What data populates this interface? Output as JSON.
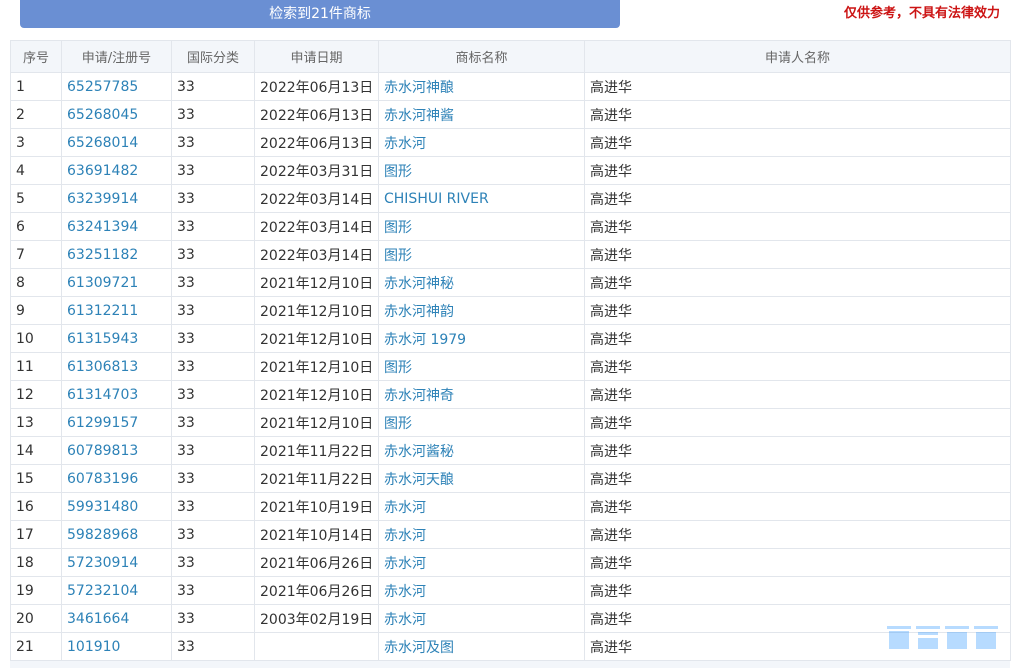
{
  "header": {
    "result_label": "检索到21件商标",
    "disclaimer": "仅供参考，不具有法律效力"
  },
  "columns": [
    "序号",
    "申请/注册号",
    "国际分类",
    "申请日期",
    "商标名称",
    "申请人名称"
  ],
  "rows": [
    {
      "no": "1",
      "reg": "65257785",
      "cls": "33",
      "date": "2022年06月13日",
      "name": "赤水河神酿",
      "applicant": "高进华"
    },
    {
      "no": "2",
      "reg": "65268045",
      "cls": "33",
      "date": "2022年06月13日",
      "name": "赤水河神酱",
      "applicant": "高进华"
    },
    {
      "no": "3",
      "reg": "65268014",
      "cls": "33",
      "date": "2022年06月13日",
      "name": "赤水河",
      "applicant": "高进华"
    },
    {
      "no": "4",
      "reg": "63691482",
      "cls": "33",
      "date": "2022年03月31日",
      "name": "图形",
      "applicant": "高进华"
    },
    {
      "no": "5",
      "reg": "63239914",
      "cls": "33",
      "date": "2022年03月14日",
      "name": "CHISHUI RIVER",
      "applicant": "高进华"
    },
    {
      "no": "6",
      "reg": "63241394",
      "cls": "33",
      "date": "2022年03月14日",
      "name": "图形",
      "applicant": "高进华"
    },
    {
      "no": "7",
      "reg": "63251182",
      "cls": "33",
      "date": "2022年03月14日",
      "name": "图形",
      "applicant": "高进华"
    },
    {
      "no": "8",
      "reg": "61309721",
      "cls": "33",
      "date": "2021年12月10日",
      "name": "赤水河神秘",
      "applicant": "高进华"
    },
    {
      "no": "9",
      "reg": "61312211",
      "cls": "33",
      "date": "2021年12月10日",
      "name": "赤水河神韵",
      "applicant": "高进华"
    },
    {
      "no": "10",
      "reg": "61315943",
      "cls": "33",
      "date": "2021年12月10日",
      "name": "赤水河 1979",
      "applicant": "高进华"
    },
    {
      "no": "11",
      "reg": "61306813",
      "cls": "33",
      "date": "2021年12月10日",
      "name": "图形",
      "applicant": "高进华"
    },
    {
      "no": "12",
      "reg": "61314703",
      "cls": "33",
      "date": "2021年12月10日",
      "name": "赤水河神奇",
      "applicant": "高进华"
    },
    {
      "no": "13",
      "reg": "61299157",
      "cls": "33",
      "date": "2021年12月10日",
      "name": "图形",
      "applicant": "高进华"
    },
    {
      "no": "14",
      "reg": "60789813",
      "cls": "33",
      "date": "2021年11月22日",
      "name": "赤水河酱秘",
      "applicant": "高进华"
    },
    {
      "no": "15",
      "reg": "60783196",
      "cls": "33",
      "date": "2021年11月22日",
      "name": "赤水河天酿",
      "applicant": "高进华"
    },
    {
      "no": "16",
      "reg": "59931480",
      "cls": "33",
      "date": "2021年10月19日",
      "name": "赤水河",
      "applicant": "高进华"
    },
    {
      "no": "17",
      "reg": "59828968",
      "cls": "33",
      "date": "2021年10月14日",
      "name": "赤水河",
      "applicant": "高进华"
    },
    {
      "no": "18",
      "reg": "57230914",
      "cls": "33",
      "date": "2021年06月26日",
      "name": "赤水河",
      "applicant": "高进华"
    },
    {
      "no": "19",
      "reg": "57232104",
      "cls": "33",
      "date": "2021年06月26日",
      "name": "赤水河",
      "applicant": "高进华"
    },
    {
      "no": "20",
      "reg": "3461664",
      "cls": "33",
      "date": "2003年02月19日",
      "name": "赤水河",
      "applicant": "高进华"
    },
    {
      "no": "21",
      "reg": "101910",
      "cls": "33",
      "date": "",
      "name": "赤水河及图",
      "applicant": "高进华"
    }
  ],
  "watermark": "西秦会馆",
  "colors": {
    "result_bar": "#6a8fd3",
    "disclaimer": "#cc1414",
    "link": "#2d82b7",
    "header_bg": "#f3f6fa",
    "border": "#e2e6ec"
  }
}
